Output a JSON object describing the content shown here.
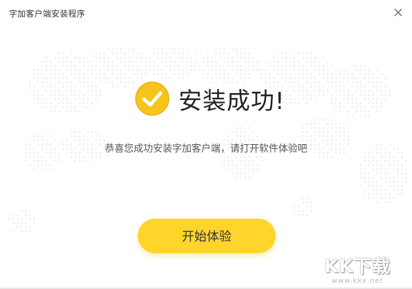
{
  "window": {
    "title": "字加客户端安装程序"
  },
  "success": {
    "icon": "check-circle-icon",
    "title": "安装成功!"
  },
  "message": "恭喜您成功安装字加客户端，请打开软件体验吧",
  "start_button": {
    "label": "开始体验"
  },
  "watermark": {
    "logo": "KK下载",
    "url": "www.kkx.net"
  },
  "colors": {
    "accent": "#FFD52C",
    "check_icon": "#F7C41C",
    "map_dots": "#EEF3FA"
  }
}
